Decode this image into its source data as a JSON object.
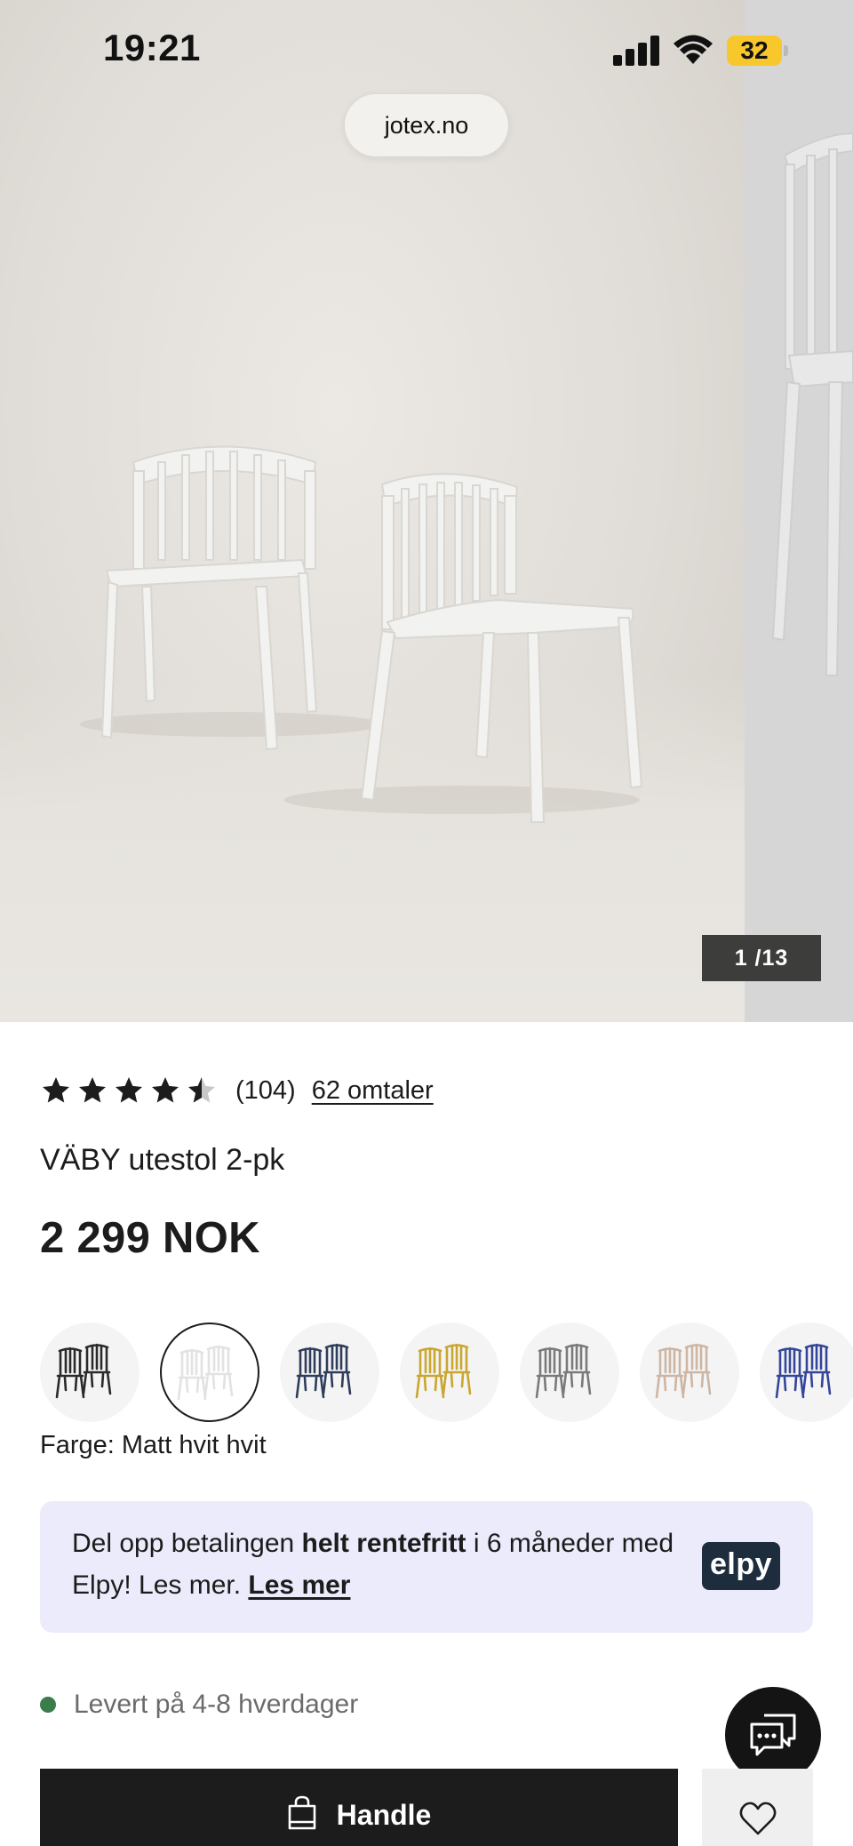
{
  "status_bar": {
    "time": "19:21",
    "battery": "32",
    "battery_color": "#f7c72b"
  },
  "browser": {
    "url": "jotex.no"
  },
  "gallery": {
    "counter": "1 /13",
    "current_index": 1,
    "total": 13
  },
  "product": {
    "rating": 4.5,
    "rating_count": "(104)",
    "reviews_link": "62 omtaler",
    "title": "VÄBY utestol 2-pk",
    "price": "2 299 NOK"
  },
  "colors": {
    "label": "Farge: Matt hvit hvit",
    "swatches": [
      {
        "name": "black",
        "hex": "#2a2a2a",
        "selected": false
      },
      {
        "name": "white",
        "hex": "#e2e2e2",
        "selected": true
      },
      {
        "name": "navy",
        "hex": "#2f3d5c",
        "selected": false
      },
      {
        "name": "yellow",
        "hex": "#c9a62e",
        "selected": false
      },
      {
        "name": "grey",
        "hex": "#7a7a7a",
        "selected": false
      },
      {
        "name": "beige",
        "hex": "#cdb5a4",
        "selected": false
      },
      {
        "name": "blue",
        "hex": "#34459a",
        "selected": false
      }
    ]
  },
  "financing": {
    "text_1": "Del opp betalingen ",
    "text_bold": "helt rentefritt",
    "text_2": " i 6 måneder med Elpy! Les mer. ",
    "link": "Les mer",
    "logo": "elpy",
    "background": "#ebebfb"
  },
  "delivery": {
    "text": "Levert på 4-8 hverdager",
    "dot_color": "#3a7d4a"
  },
  "actions": {
    "buy_label": "Handle",
    "buy_icon": "shopping-bag-icon",
    "wishlist_icon": "heart-icon",
    "chat_icon": "chat-bubble-icon"
  }
}
